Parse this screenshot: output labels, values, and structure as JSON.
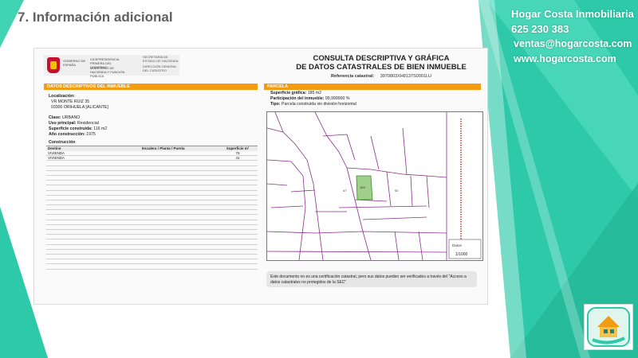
{
  "slide": {
    "title": "7. Información adicional"
  },
  "brand": {
    "name": "Hogar Costa Inmobiliaria",
    "phone": "625 230 383",
    "email": "ventas@hogarcosta.com",
    "web": "www.hogarcosta.com"
  },
  "colors": {
    "teal": "#2ec9a9",
    "orange": "#f39c12",
    "map_lines": "#8b2e8b"
  },
  "document": {
    "gov": {
      "gobierno": "GOBIERNO DE ESPAÑA",
      "vice": "VICEPRESIDENCIA PRIMERA DEL GOBIERNO",
      "ministerio": "MINISTERIO DE HACIENDA Y FUNCIÓN PÚBLICA",
      "secretaria": "SECRETARÍA DE ESTADO DE HACIENDA",
      "direccion": "DIRECCIÓN GENERAL DEL CATASTRO"
    },
    "title_line1": "CONSULTA DESCRIPTIVA Y GRÁFICA",
    "title_line2": "DE DATOS CATASTRALES DE BIEN INMUEBLE",
    "ref_label": "Referencia catastral:",
    "ref_value": "3970803XH8137S0001LU",
    "left_section": "DATOS DESCRIPTIVOS DEL INMUEBLE",
    "right_section": "PARCELA",
    "localizacion_label": "Localización:",
    "address1": "VR MONTE RUIZ 35",
    "address2": "03300 ORIHUELA [ALICANTE]",
    "clase_label": "Clase:",
    "clase": "URBANO",
    "uso_label": "Uso principal:",
    "uso": "Residencial",
    "sup_label": "Superficie construida:",
    "sup": "116 m2",
    "anio_label": "Año construcción:",
    "anio": "1975",
    "construccion_label": "Construcción",
    "table": {
      "headers": [
        "Destino",
        "Escalera / Planta / Puerta",
        "Superficie m²"
      ],
      "rows": [
        [
          "VIVIENDA",
          "",
          "75"
        ],
        [
          "VIVIENDA",
          "",
          "41"
        ]
      ]
    },
    "sup_grafica_label": "Superficie gráfica:",
    "sup_grafica": "185 m2",
    "participacion_label": "Participación del inmueble:",
    "participacion": "99,999900 %",
    "tipo_label": "Tipo:",
    "tipo": "Parcela construida sin división horizontal",
    "note": "Este documento no es una certificación catastral, pero sus datos pueden ser verificados a través del \"Acceso a datos catastrales no protegidos de la SEC\"",
    "map": {
      "scale": "1/1000",
      "datos_label": "Datos",
      "parcel_a": "183",
      "parcel_b": "92",
      "parcel_c": "47"
    }
  }
}
